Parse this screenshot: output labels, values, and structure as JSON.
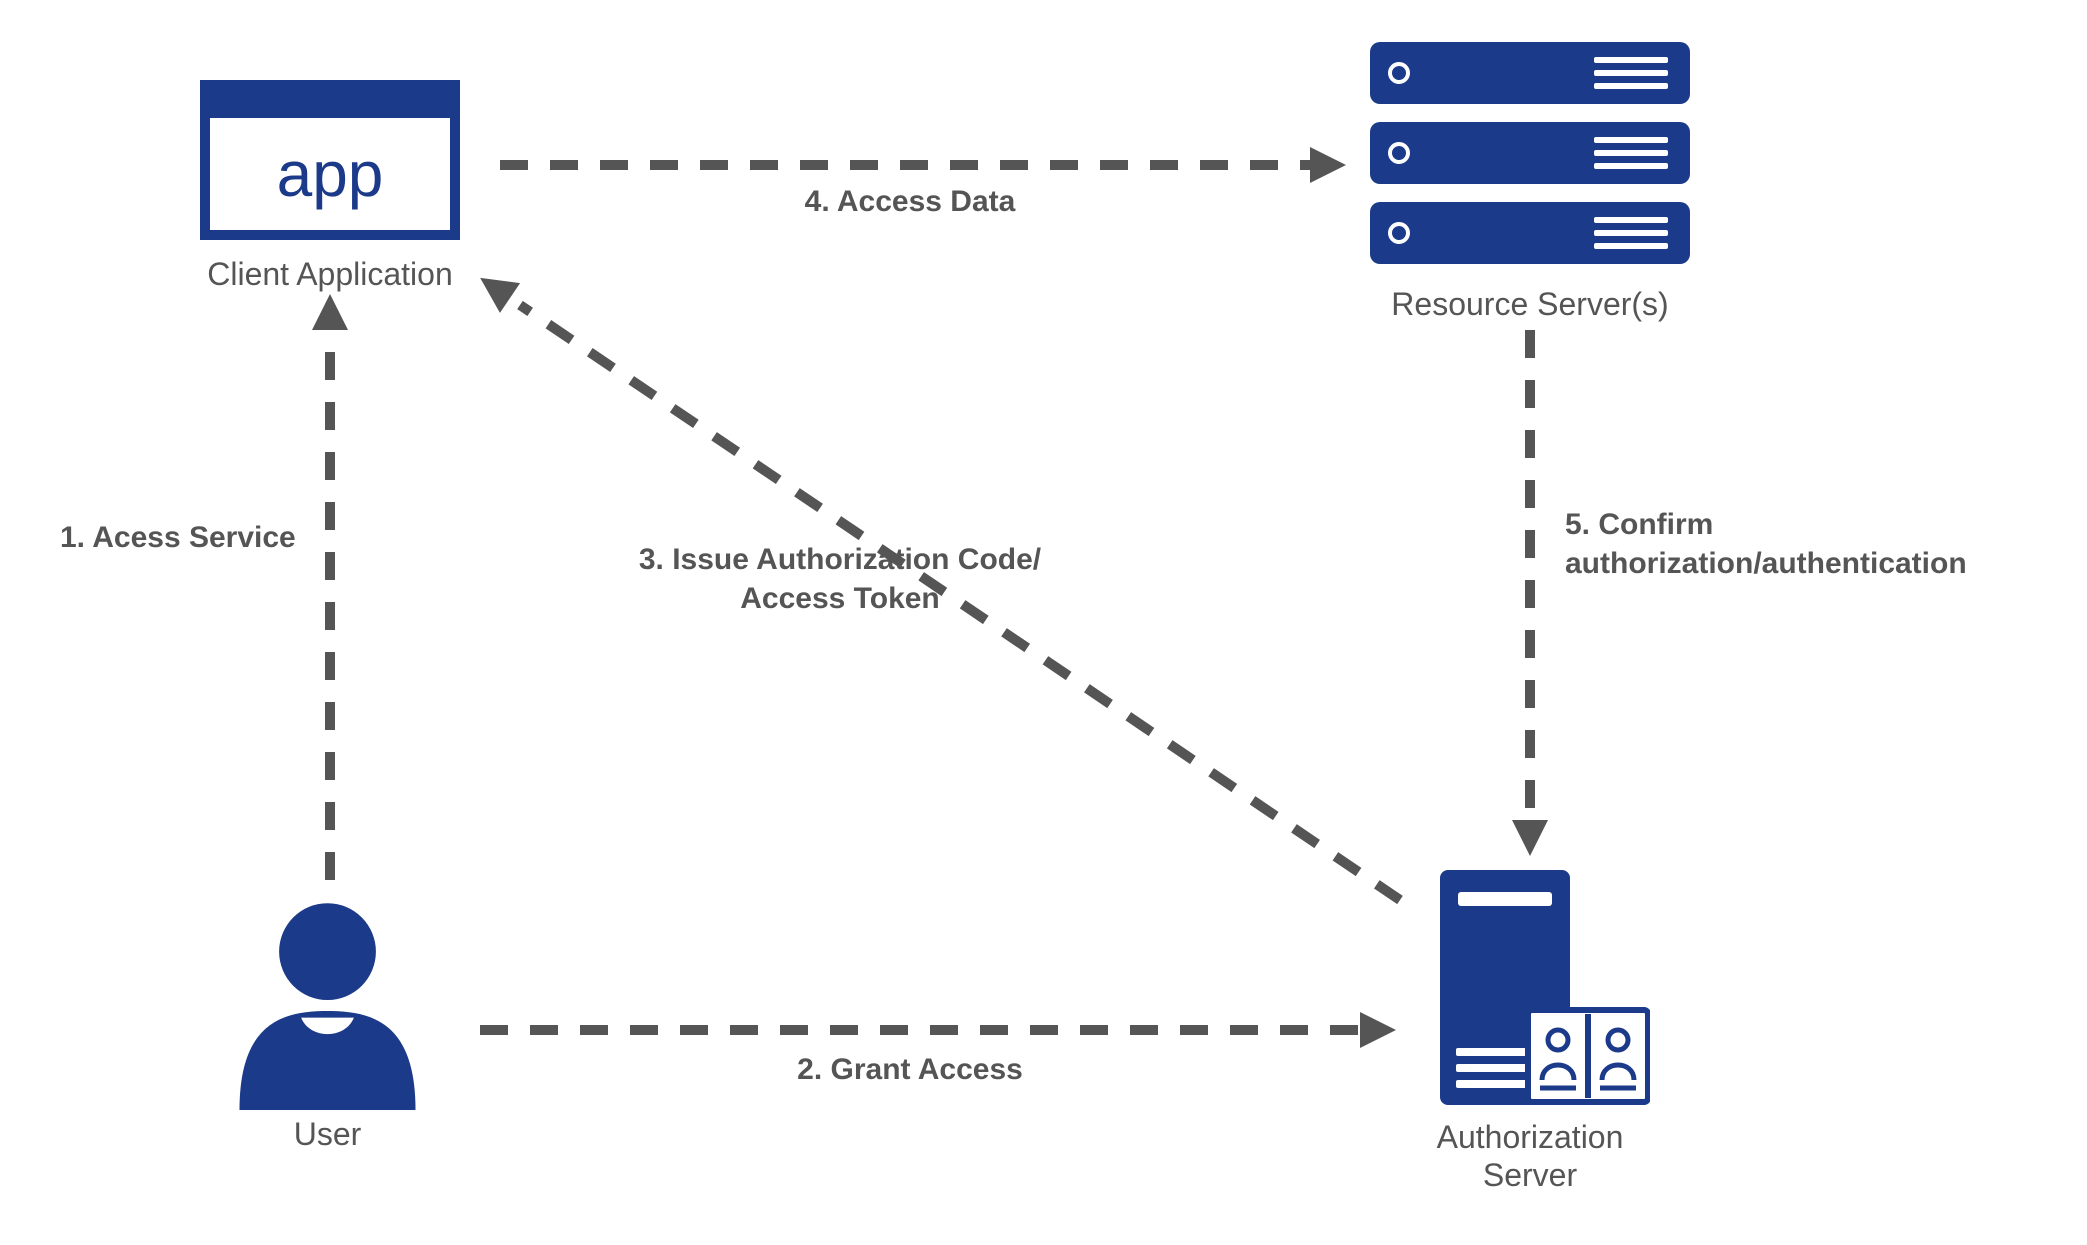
{
  "nodes": {
    "client_app": {
      "label": "Client Application",
      "badge_text": "app"
    },
    "resource_server": {
      "label": "Resource Server(s)"
    },
    "user": {
      "label": "User"
    },
    "auth_server": {
      "label": "Authorization\nServer"
    }
  },
  "edges": {
    "e1": {
      "label": "1. Acess Service",
      "from": "user",
      "to": "client_app"
    },
    "e2": {
      "label": "2. Grant Access",
      "from": "user",
      "to": "auth_server"
    },
    "e3": {
      "label": "3. Issue Authorization Code/\nAccess Token",
      "from": "auth_server",
      "to": "client_app"
    },
    "e4": {
      "label": "4. Access Data",
      "from": "client_app",
      "to": "resource_server"
    },
    "e5": {
      "label": "5. Confirm\nauthorization/authentication",
      "from": "resource_server",
      "to": "auth_server"
    }
  },
  "colors": {
    "brand": "#1c3a8a",
    "line": "#555555"
  }
}
